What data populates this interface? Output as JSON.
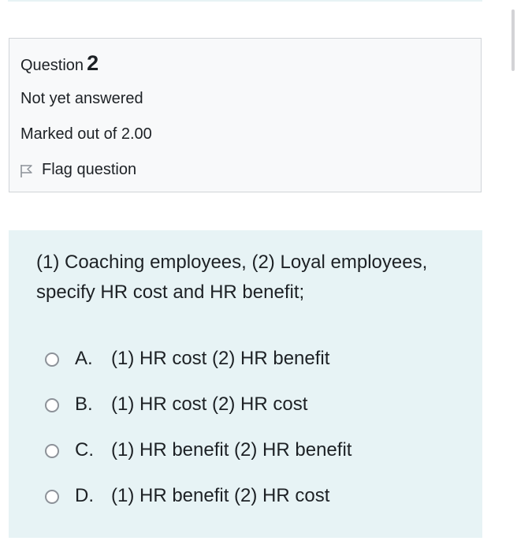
{
  "question_info": {
    "label": "Question",
    "number": "2",
    "state": "Not yet answered",
    "grade": "Marked out of 2.00",
    "flag_label": "Flag question"
  },
  "question": {
    "text": "(1) Coaching employees, (2) Loyal employees, specify HR cost and HR benefit;",
    "options": [
      {
        "letter": "A.",
        "text": "(1) HR cost (2) HR benefit"
      },
      {
        "letter": "B.",
        "text": "(1) HR cost (2) HR cost"
      },
      {
        "letter": "C.",
        "text": "(1) HR benefit (2) HR benefit"
      },
      {
        "letter": "D.",
        "text": "(1) HR benefit (2) HR cost"
      }
    ]
  },
  "colors": {
    "info_background": "#f8f9fa",
    "info_border": "#d0d4d8",
    "content_background": "#e7f3f5",
    "text": "#1d2125"
  },
  "icons": {
    "flag": "flag-outline-icon",
    "radio": "radio-unchecked"
  }
}
